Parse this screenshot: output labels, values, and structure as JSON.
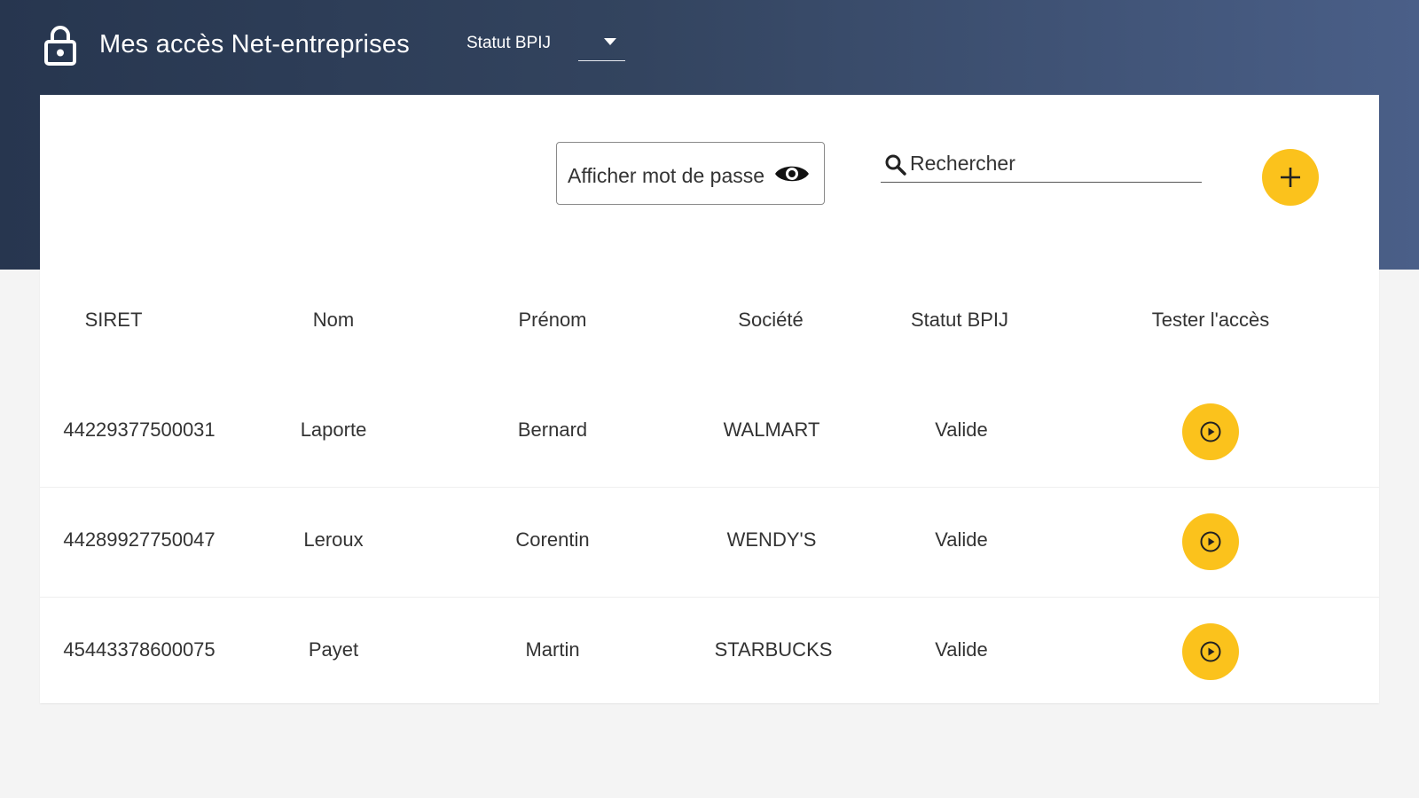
{
  "header": {
    "title": "Mes accès Net-entreprises",
    "filter_label": "Statut BPIJ",
    "filter_value": "",
    "bg_color_start": "#27364f",
    "bg_color_end": "#4a5f88"
  },
  "toolbar": {
    "show_password_label": "Afficher mot de passe",
    "search_placeholder": "Rechercher",
    "add_icon": "plus-icon",
    "accent_color": "#fbc21c"
  },
  "table": {
    "columns": [
      "SIRET",
      "Nom",
      "Prénom",
      "Société",
      "Statut BPIJ",
      "Tester l'accès"
    ],
    "rows": [
      {
        "siret": "44229377500031",
        "nom": "Laporte",
        "prenom": "Bernard",
        "societe": "WALMART",
        "statut": "Valide",
        "action_icon": "play-icon"
      },
      {
        "siret": "44289927750047",
        "nom": "Leroux",
        "prenom": "Corentin",
        "societe": "WENDY'S",
        "statut": "Valide",
        "action_icon": "play-icon"
      },
      {
        "siret": "45443378600075",
        "nom": "Payet",
        "prenom": "Martin",
        "societe": "STARBUCKS",
        "statut": "Valide",
        "action_icon": "play-icon"
      }
    ]
  }
}
